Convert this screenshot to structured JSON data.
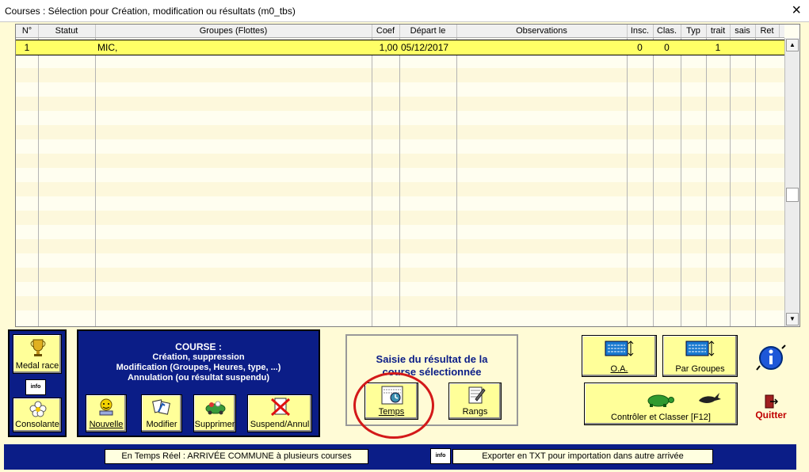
{
  "window": {
    "title": "Courses : Sélection pour Création, modification ou résultats    (m0_tbs)",
    "close_glyph": "×"
  },
  "grid": {
    "columns": [
      "N°",
      "Statut",
      "Groupes (Flottes)",
      "Coef",
      "Départ le",
      "Observations",
      "Insc.",
      "Clas.",
      "Typ",
      "trait",
      "sais",
      "Ret"
    ],
    "rows": [
      {
        "num": "1",
        "statut": "",
        "groupes": "MIC,",
        "coef": "1,00",
        "depart": "05/12/2017",
        "observations": "",
        "insc": "0",
        "clas": "0",
        "typ": "",
        "trait": "1",
        "sais": "",
        "ret": ""
      }
    ],
    "scroll_up": "▲",
    "scroll_down": "▼"
  },
  "left": {
    "medal_race": "Medal race",
    "consolante": "Consolante",
    "info_icon": "info"
  },
  "course_panel": {
    "title_lines": [
      "COURSE :",
      "Création, suppression",
      "Modification (Groupes, Heures, type, ...)",
      "Annulation (ou résultat suspendu)"
    ],
    "buttons": {
      "nouvelle": "Nouvelle",
      "modifier": "Modifier",
      "supprimer": "Supprimer",
      "suspend": "Suspend/Annul"
    }
  },
  "saisie": {
    "text_lines": [
      "Saisie du résultat de la",
      "course sélectionnée"
    ],
    "temps": "Temps",
    "rangs": "Rangs"
  },
  "right": {
    "oa": "O.A.",
    "par_groupes": "Par Groupes",
    "controler": "Contrôler et Classer [F12]",
    "quitter": "Quitter"
  },
  "bottom": {
    "temps_reel": "En Temps Réel : ARRIVÉE COMMUNE à plusieurs courses",
    "exporter": "Exporter  en TXT pour importation dans  autre arrivée",
    "info_icon": "info"
  },
  "colors": {
    "accent_blue": "#0b1d87",
    "selected_row": "#ffff66",
    "button_face": "#ffff99",
    "highlight_circle": "#d31919"
  }
}
